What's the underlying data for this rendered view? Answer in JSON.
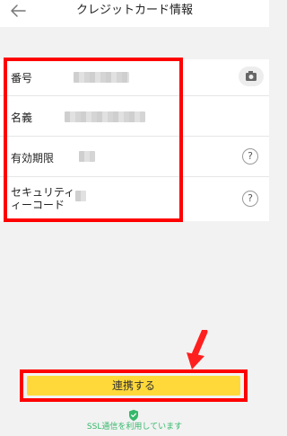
{
  "header": {
    "title": "クレジットカード情報"
  },
  "form": {
    "number": {
      "label": "番号"
    },
    "name": {
      "label": "名義"
    },
    "expiry": {
      "label": "有効期限"
    },
    "security_code": {
      "label_line1": "セキュリティ",
      "label_line2": "ィーコード"
    }
  },
  "icons": {
    "back": "back-arrow-icon",
    "camera": "camera-icon",
    "help": "question-icon",
    "shield": "shield-check-icon"
  },
  "actions": {
    "connect_label": "連携する"
  },
  "footer": {
    "ssl_text": "SSL通信を利用しています"
  },
  "colors": {
    "highlight": "#ff0000",
    "button_bg": "#ffd93a",
    "ssl_green": "#35b86b"
  }
}
